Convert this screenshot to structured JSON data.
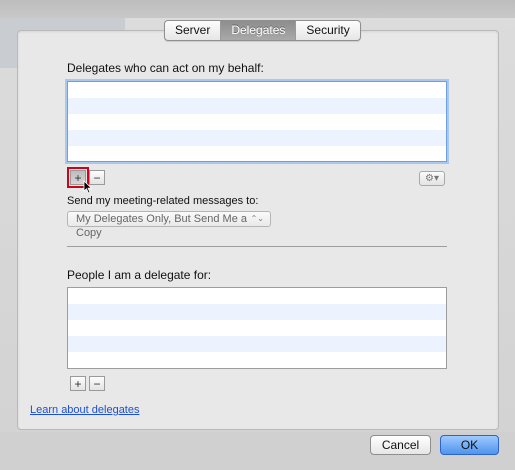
{
  "tabs": [
    {
      "label": "Server"
    },
    {
      "label": "Delegates"
    },
    {
      "label": "Security"
    }
  ],
  "delegates": {
    "heading": "Delegates who can act on my behalf:",
    "add_label": "+",
    "remove_label": "−",
    "gear_label": "⚙▾",
    "send_label": "Send my meeting-related messages to:",
    "send_option_selected": "My Delegates Only, But Send Me a Copy",
    "send_option_arrows": "⌃⌄"
  },
  "delegate_for": {
    "heading": "People I am a delegate for:",
    "add_label": "+",
    "remove_label": "−"
  },
  "footer": {
    "learn_link": "Learn about delegates",
    "cancel_label": "Cancel",
    "ok_label": "OK"
  },
  "colors": {
    "accent_focus": "#6f9fdc",
    "row_alt": "#edf3fe",
    "link": "#1b4fd8",
    "highlight_box": "#d0021b",
    "ok_button": "#4f94ec"
  }
}
